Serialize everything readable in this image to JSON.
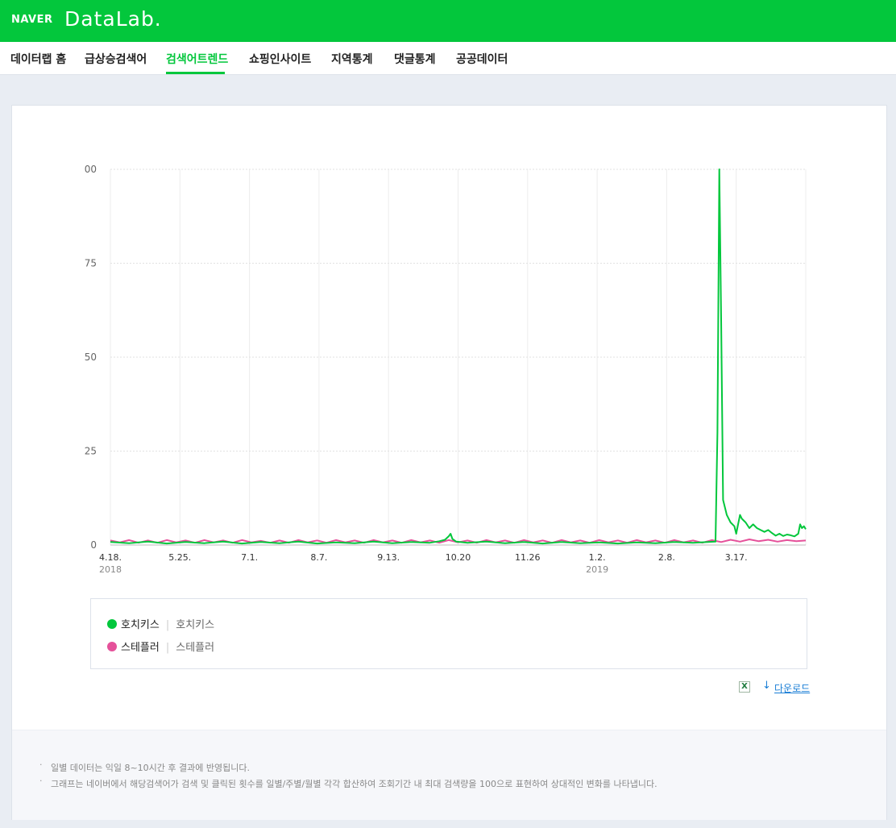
{
  "header": {
    "naver": "NAVER",
    "datalab": "DataLab."
  },
  "nav": {
    "items": [
      "데이터랩 홈",
      "급상승검색어",
      "검색어트렌드",
      "쇼핑인사이트",
      "지역통계",
      "댓글통계",
      "공공데이터"
    ],
    "active": "검색어트렌드"
  },
  "colors": {
    "brand": "#03c73c",
    "series_1": "#03c73c",
    "series_2": "#e5519a"
  },
  "chart_data": {
    "type": "line",
    "y_tick_labels": [
      "0",
      "25",
      "50",
      "75",
      "00"
    ],
    "y_ticks": [
      0,
      25,
      50,
      75,
      100
    ],
    "ylim": [
      0,
      100
    ],
    "x_tick_labels": [
      "4.18.",
      "5.25.",
      "7.1.",
      "8.7.",
      "9.13.",
      "10.20",
      "11.26",
      "1.2.",
      "2.8.",
      "3.17."
    ],
    "x_year_labels": [
      {
        "tick": 0,
        "text": "2018"
      },
      {
        "tick": 7,
        "text": "2019"
      }
    ],
    "x_tick_days": [
      0,
      37,
      74,
      111,
      148,
      185,
      222,
      259,
      296,
      333
    ],
    "x_max_day": 370,
    "series": [
      {
        "name": "호치키스",
        "terms": "호치키스",
        "points": [
          [
            0,
            0.8
          ],
          [
            10,
            0.5
          ],
          [
            20,
            0.9
          ],
          [
            30,
            0.4
          ],
          [
            40,
            0.8
          ],
          [
            50,
            0.5
          ],
          [
            60,
            0.9
          ],
          [
            70,
            0.4
          ],
          [
            80,
            0.8
          ],
          [
            90,
            0.5
          ],
          [
            100,
            0.9
          ],
          [
            110,
            0.4
          ],
          [
            120,
            0.7
          ],
          [
            130,
            0.5
          ],
          [
            140,
            0.9
          ],
          [
            150,
            0.5
          ],
          [
            160,
            0.8
          ],
          [
            170,
            0.6
          ],
          [
            175,
            1.0
          ],
          [
            178,
            1.4
          ],
          [
            180,
            2.3
          ],
          [
            181,
            3.0
          ],
          [
            182,
            1.6
          ],
          [
            184,
            0.9
          ],
          [
            190,
            0.6
          ],
          [
            200,
            0.9
          ],
          [
            210,
            0.5
          ],
          [
            220,
            0.8
          ],
          [
            230,
            0.4
          ],
          [
            240,
            0.8
          ],
          [
            250,
            0.5
          ],
          [
            260,
            0.7
          ],
          [
            270,
            0.4
          ],
          [
            280,
            0.7
          ],
          [
            290,
            0.5
          ],
          [
            300,
            0.8
          ],
          [
            310,
            0.6
          ],
          [
            318,
            0.8
          ],
          [
            322,
            0.9
          ],
          [
            323,
            30
          ],
          [
            324,
            100
          ],
          [
            325,
            60
          ],
          [
            326,
            12
          ],
          [
            327,
            10
          ],
          [
            328,
            8
          ],
          [
            330,
            6
          ],
          [
            332,
            5
          ],
          [
            333,
            3
          ],
          [
            334,
            5.5
          ],
          [
            335,
            8
          ],
          [
            336,
            7
          ],
          [
            338,
            6
          ],
          [
            340,
            4.5
          ],
          [
            342,
            5.5
          ],
          [
            344,
            4.5
          ],
          [
            346,
            4
          ],
          [
            348,
            3.5
          ],
          [
            350,
            4
          ],
          [
            352,
            3.2
          ],
          [
            354,
            2.5
          ],
          [
            356,
            3
          ],
          [
            358,
            2.4
          ],
          [
            360,
            2.8
          ],
          [
            362,
            2.6
          ],
          [
            364,
            2.3
          ],
          [
            366,
            3
          ],
          [
            367,
            5.5
          ],
          [
            368,
            4.5
          ],
          [
            369,
            5
          ],
          [
            370,
            4.2
          ]
        ]
      },
      {
        "name": "스테플러",
        "terms": "스테플러",
        "points": [
          [
            0,
            1.2
          ],
          [
            5,
            0.7
          ],
          [
            10,
            1.3
          ],
          [
            15,
            0.6
          ],
          [
            20,
            1.2
          ],
          [
            25,
            0.6
          ],
          [
            30,
            1.3
          ],
          [
            35,
            0.7
          ],
          [
            40,
            1.2
          ],
          [
            45,
            0.6
          ],
          [
            50,
            1.3
          ],
          [
            55,
            0.7
          ],
          [
            60,
            1.2
          ],
          [
            65,
            0.6
          ],
          [
            70,
            1.3
          ],
          [
            75,
            0.7
          ],
          [
            80,
            1.1
          ],
          [
            85,
            0.6
          ],
          [
            90,
            1.2
          ],
          [
            95,
            0.6
          ],
          [
            100,
            1.3
          ],
          [
            105,
            0.7
          ],
          [
            110,
            1.2
          ],
          [
            115,
            0.6
          ],
          [
            120,
            1.3
          ],
          [
            125,
            0.7
          ],
          [
            130,
            1.2
          ],
          [
            135,
            0.6
          ],
          [
            140,
            1.3
          ],
          [
            145,
            0.7
          ],
          [
            150,
            1.2
          ],
          [
            155,
            0.6
          ],
          [
            160,
            1.3
          ],
          [
            165,
            0.7
          ],
          [
            170,
            1.2
          ],
          [
            175,
            0.6
          ],
          [
            180,
            1.3
          ],
          [
            185,
            0.7
          ],
          [
            190,
            1.2
          ],
          [
            195,
            0.6
          ],
          [
            200,
            1.3
          ],
          [
            205,
            0.7
          ],
          [
            210,
            1.2
          ],
          [
            215,
            0.6
          ],
          [
            220,
            1.3
          ],
          [
            225,
            0.7
          ],
          [
            230,
            1.2
          ],
          [
            235,
            0.6
          ],
          [
            240,
            1.3
          ],
          [
            245,
            0.7
          ],
          [
            250,
            1.2
          ],
          [
            255,
            0.6
          ],
          [
            260,
            1.3
          ],
          [
            265,
            0.7
          ],
          [
            270,
            1.2
          ],
          [
            275,
            0.6
          ],
          [
            280,
            1.3
          ],
          [
            285,
            0.7
          ],
          [
            290,
            1.2
          ],
          [
            295,
            0.6
          ],
          [
            300,
            1.3
          ],
          [
            305,
            0.7
          ],
          [
            310,
            1.2
          ],
          [
            315,
            0.6
          ],
          [
            320,
            1.3
          ],
          [
            325,
            0.8
          ],
          [
            330,
            1.4
          ],
          [
            335,
            0.9
          ],
          [
            340,
            1.5
          ],
          [
            345,
            1.0
          ],
          [
            350,
            1.4
          ],
          [
            355,
            0.9
          ],
          [
            360,
            1.3
          ],
          [
            365,
            1.0
          ],
          [
            370,
            1.2
          ]
        ]
      }
    ]
  },
  "actions": {
    "excel_icon": "excel-icon",
    "download_arrow": "↓",
    "download_label": "다운로드"
  },
  "notes": [
    "일별 데이터는 익일 8~10시간 후 결과에 반영됩니다.",
    "그래프는 네이버에서 해당검색어가 검색 및 클릭된 횟수를 일별/주별/월별 각각 합산하여 조회기간 내 최대 검색량을 100으로 표현하여 상대적인 변화를 나타냅니다."
  ]
}
